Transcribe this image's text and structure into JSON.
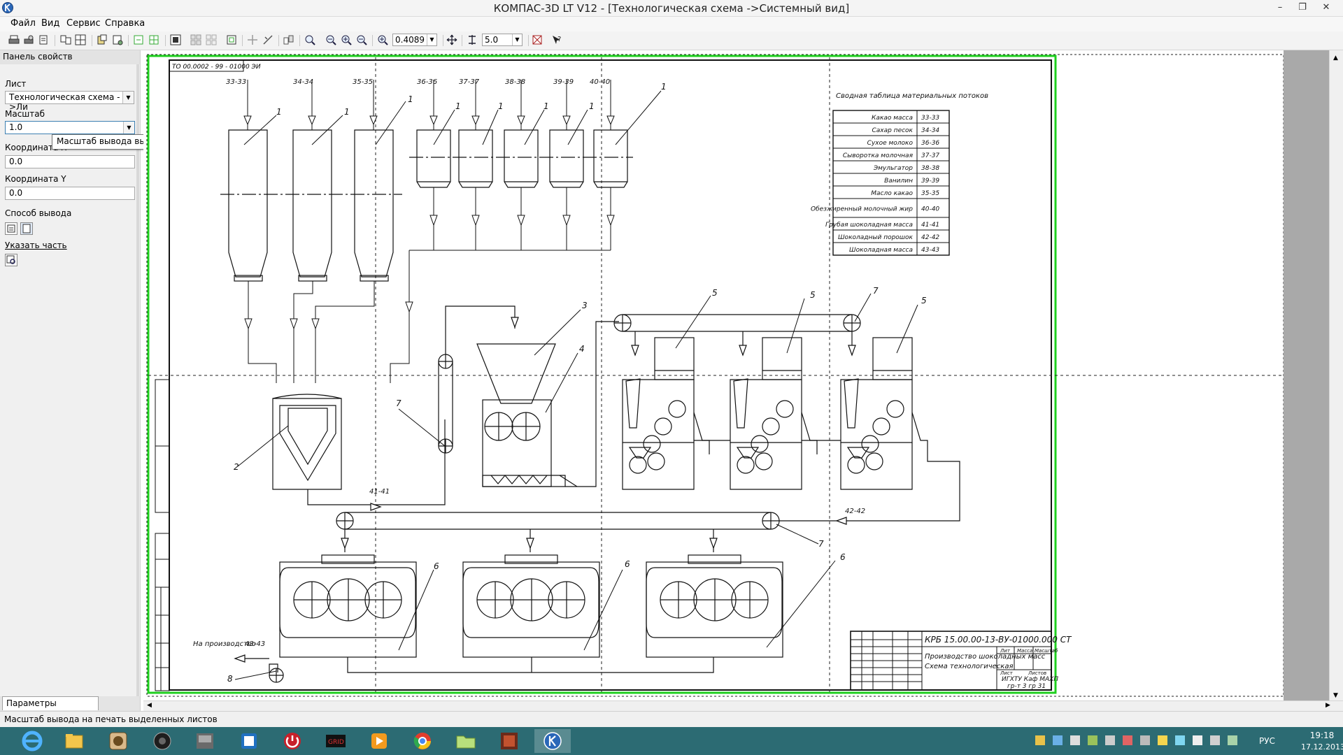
{
  "window": {
    "title": "КОМПАС-3D LT V12 - [Технологическая схема ->Системный вид]",
    "controls": [
      "–",
      "❐",
      "✕"
    ]
  },
  "menu": [
    "Файл",
    "Вид",
    "Сервис",
    "Справка"
  ],
  "toolbar": {
    "zoom_value": "0.4089",
    "step_value": "5.0"
  },
  "panel": {
    "title": "Панель свойств",
    "sheet_label": "Лист",
    "sheet_value": "Технологическая схема ->Ли",
    "scale_label": "Масштаб",
    "scale_value": "1.0",
    "coord_x_label": "Координата X",
    "coord_x_value": "0.0",
    "coord_y_label": "Координата Y",
    "coord_y_value": "0.0",
    "output_mode_label": "Способ вывода",
    "select_part_label": "Указать часть",
    "tooltip": "Масштаб вывода выделенных листов",
    "bottom_tab": "Параметры просмотра"
  },
  "status": "Масштаб вывода на печать выделенных листов",
  "drawing": {
    "stamp_code": "ТО 00.0002 - 99 - 01000 ЭИ",
    "table_title": "Сводная таблица материальных потоков",
    "table_rows": [
      [
        "Какао масса",
        "33-33"
      ],
      [
        "Сахар песок",
        "34-34"
      ],
      [
        "Сухое молоко",
        "36-36"
      ],
      [
        "Сыворотка молочная",
        "37-37"
      ],
      [
        "Эмульгатор",
        "38-38"
      ],
      [
        "Ванилин",
        "39-39"
      ],
      [
        "Масло какао",
        "35-35"
      ],
      [
        "Обезжиренный молочный жир",
        "40-40"
      ],
      [
        "Грубая шоколадная масса",
        "41-41"
      ],
      [
        "Шоколадный порошок",
        "42-42"
      ],
      [
        "Шоколадная масса",
        "43-43"
      ]
    ],
    "flow_labels_top": [
      "33-33",
      "34-34",
      "35-35",
      "36-36",
      "37-37",
      "38-38",
      "39-39",
      "40-40"
    ],
    "flow_41": "41-41",
    "flow_42": "42-42",
    "flow_43": "43-43",
    "to_production": "На производство",
    "title_block": {
      "code": "КРБ 15.00.00-13-ВУ-01000.000 СТ",
      "line1": "Производство шоколадных масс",
      "line2": "Схема технологическая",
      "org": "ИГХТУ Каф МАХП",
      "group": "гр-т 3 гр 31",
      "col_lit": "Лит",
      "col_mass": "Масса",
      "col_scale": "Масштаб",
      "sheet": "Лист",
      "sheets": "Листов"
    }
  },
  "clock": {
    "time": "19:18",
    "date": "17.12.2013"
  },
  "lang": "РУС"
}
